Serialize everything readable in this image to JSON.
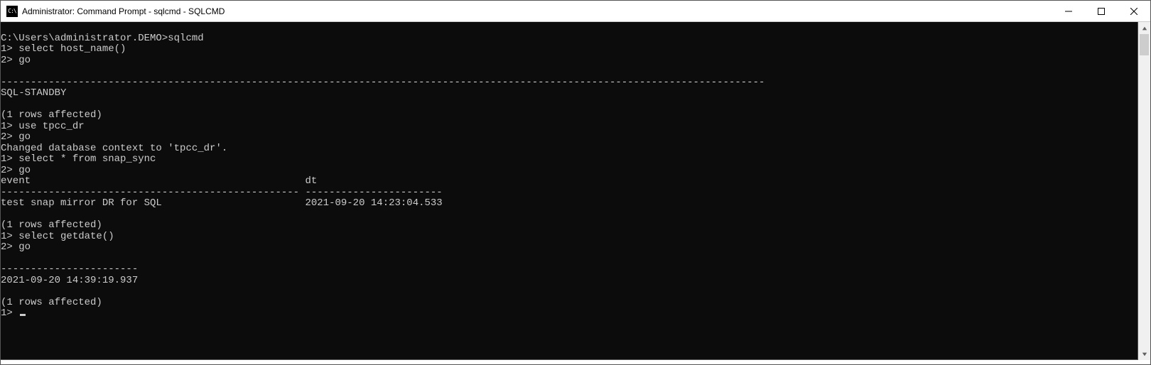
{
  "window": {
    "title": "Administrator: Command Prompt - sqlcmd - SQLCMD",
    "icon_label": "C:\\"
  },
  "terminal": {
    "lines": [
      "",
      "C:\\Users\\administrator.DEMO>sqlcmd",
      "1> select host_name()",
      "2> go",
      "",
      "--------------------------------------------------------------------------------------------------------------------------------",
      "SQL-STANDBY",
      "",
      "(1 rows affected)",
      "1> use tpcc_dr",
      "2> go",
      "Changed database context to 'tpcc_dr'.",
      "1> select * from snap_sync",
      "2> go",
      "event                                              dt",
      "-------------------------------------------------- -----------------------",
      "test snap mirror DR for SQL                        2021-09-20 14:23:04.533",
      "",
      "(1 rows affected)",
      "1> select getdate()",
      "2> go",
      "",
      "-----------------------",
      "2021-09-20 14:39:19.937",
      "",
      "(1 rows affected)",
      "1> "
    ]
  }
}
